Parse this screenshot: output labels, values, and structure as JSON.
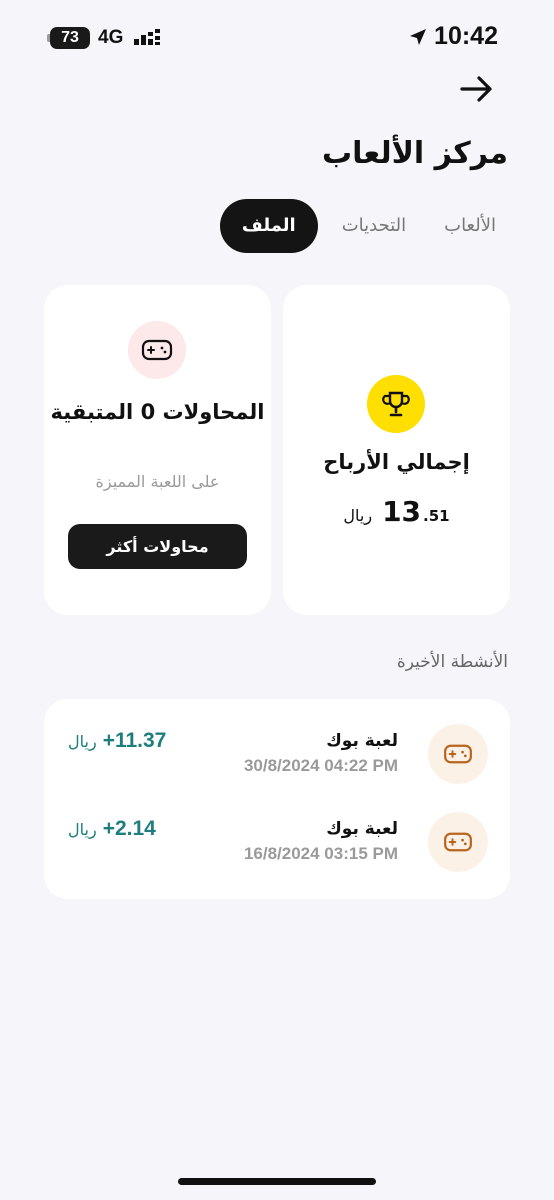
{
  "status_bar": {
    "battery": "73",
    "network": "4G",
    "time": "10:42"
  },
  "header": {
    "title": "مركز الألعاب"
  },
  "tabs": [
    {
      "label": "الألعاب",
      "active": false
    },
    {
      "label": "التحديات",
      "active": false
    },
    {
      "label": "الملف",
      "active": true
    }
  ],
  "earnings": {
    "label": "إجمالي الأرباح",
    "amount_int": "13",
    "amount_dec": ".51",
    "currency": "ريال"
  },
  "attempts": {
    "title": "المحاولات 0 المتبقية",
    "subtitle": "على اللعبة المميزة",
    "button_label": "محاولات أكثر"
  },
  "activity": {
    "title": "الأنشطة الأخيرة",
    "items": [
      {
        "name": "لعبة بوك",
        "date": "30/8/2024 04:22 PM",
        "amount": "+11.37",
        "currency": "ريال"
      },
      {
        "name": "لعبة بوك",
        "date": "16/8/2024 03:15 PM",
        "amount": "+2.14",
        "currency": "ريال"
      }
    ]
  },
  "colors": {
    "accent_yellow": "#ffdf00",
    "positive_teal": "#1e7d7d",
    "dark": "#141414"
  }
}
